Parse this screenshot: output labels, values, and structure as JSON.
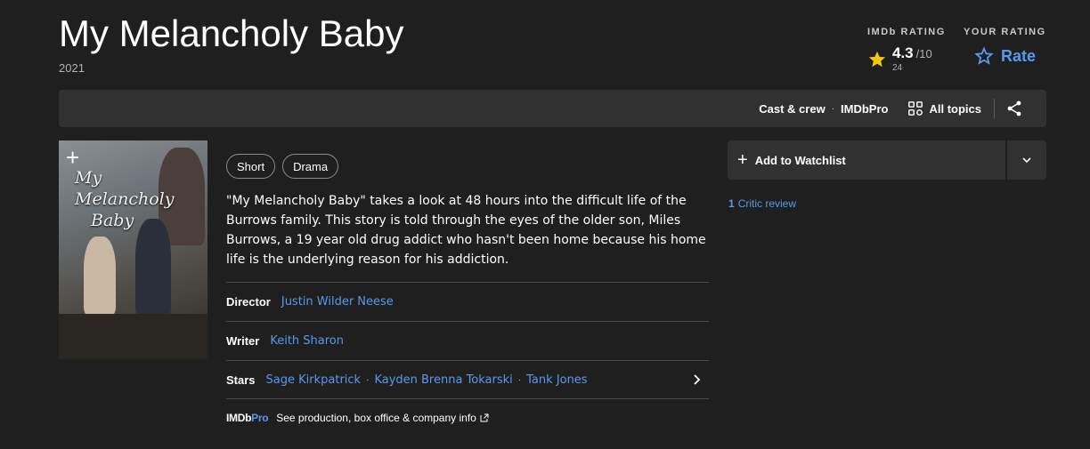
{
  "title": "My Melancholy Baby",
  "year": "2021",
  "rating": {
    "imdb_label": "IMDb RATING",
    "score": "4.3",
    "out_of": "/10",
    "votes": "24",
    "your_label": "YOUR RATING",
    "rate_label": "Rate"
  },
  "subnav": {
    "cast_crew": "Cast & crew",
    "dot": "·",
    "imdbpro": "IMDbPro",
    "all_topics": "All topics"
  },
  "poster": {
    "plus": "+",
    "title_line1": "My",
    "title_line2": "Melancholy",
    "title_line3": "Baby"
  },
  "genres": [
    "Short",
    "Drama"
  ],
  "plot": "\"My Melancholy Baby\" takes a look at 48 hours into the difficult life of the Burrows family. This story is told through the eyes of the older son, Miles Burrows, a 19 year old drug addict who hasn't been home because his home life is the underlying reason for his addiction.",
  "credits": {
    "director_label": "Director",
    "director": "Justin Wilder Neese",
    "writer_label": "Writer",
    "writer": "Keith Sharon",
    "stars_label": "Stars",
    "stars": [
      "Sage Kirkpatrick",
      "Kayden Brenna Tokarski",
      "Tank Jones"
    ],
    "dot": "·"
  },
  "pro": {
    "logo_a": "IMDb",
    "logo_b": "Pro",
    "text": "See production, box office & company info"
  },
  "watchlist": {
    "plus": "+",
    "label": "Add to Watchlist"
  },
  "critic": {
    "count": "1",
    "label": "Critic review"
  },
  "colors": {
    "background": "#1f1f1f",
    "panel": "#313131",
    "link": "#5799ef",
    "star": "#f5c518"
  },
  "icons": [
    "star-icon",
    "star-outline-icon",
    "grid-icon",
    "share-icon",
    "chevron-right-icon",
    "chevron-down-icon",
    "external-link-icon",
    "plus-icon"
  ]
}
